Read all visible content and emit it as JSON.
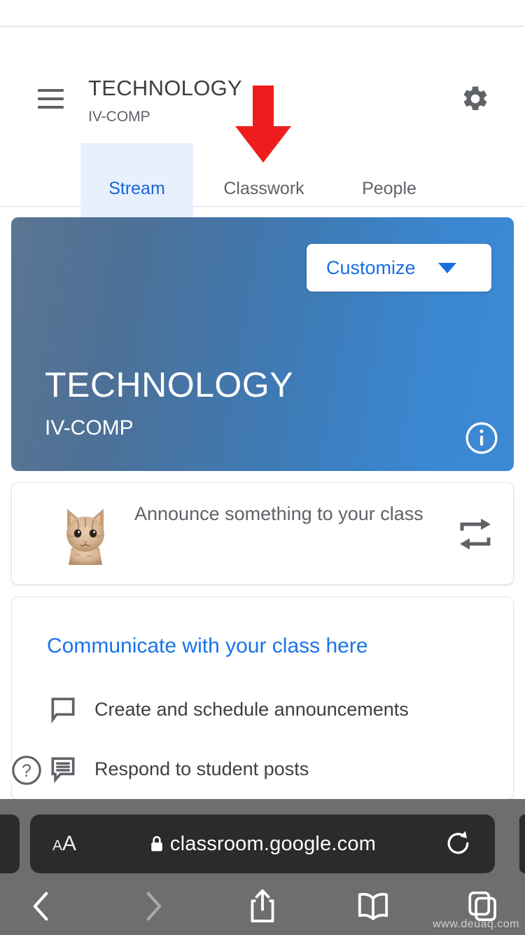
{
  "browser": {
    "url": "classroom.google.com",
    "text_size_label": "AA",
    "lock_icon": "lock-icon",
    "reload_icon": "reload-icon",
    "nav": {
      "back_icon": "chevron-left-icon",
      "forward_icon": "chevron-right-icon",
      "share_icon": "share-icon",
      "bookmarks_icon": "book-icon",
      "tabs_icon": "tabs-icon"
    },
    "watermark": "www.deuaq.com"
  },
  "header": {
    "menu_icon": "hamburger-menu-icon",
    "title": "TECHNOLOGY",
    "subtitle": "IV-COMP",
    "settings_icon": "gear-icon"
  },
  "tabs": [
    {
      "label": "Stream",
      "active": true
    },
    {
      "label": "Classwork",
      "active": false
    },
    {
      "label": "People",
      "active": false
    }
  ],
  "annotation": {
    "arrow_icon": "red-down-arrow-icon",
    "points_at": "Classwork",
    "color": "#ee1d1d"
  },
  "banner": {
    "customize_label": "Customize",
    "customize_caret_icon": "chevron-down-icon",
    "title": "TECHNOLOGY",
    "subtitle": "IV-COMP",
    "info_icon": "info-circle-icon",
    "gradient_from": "#5b7693",
    "gradient_to": "#3c89d6"
  },
  "announce_card": {
    "avatar_icon": "cat-avatar",
    "placeholder": "Announce something to your class",
    "action_icon": "swap-arrows-icon"
  },
  "communicate_card": {
    "title": "Communicate with your class here",
    "rows": [
      {
        "icon": "chat-bubble-outline-icon",
        "label": "Create and schedule announcements"
      },
      {
        "icon": "comment-lines-icon",
        "label": "Respond to student posts"
      }
    ]
  },
  "help": {
    "icon": "help-circle-icon",
    "label": "?"
  },
  "colors": {
    "accent_blue": "#1a73e8",
    "active_tab_bg": "#e8f0fe",
    "text_primary": "#3c4043",
    "text_secondary": "#5f6368"
  }
}
